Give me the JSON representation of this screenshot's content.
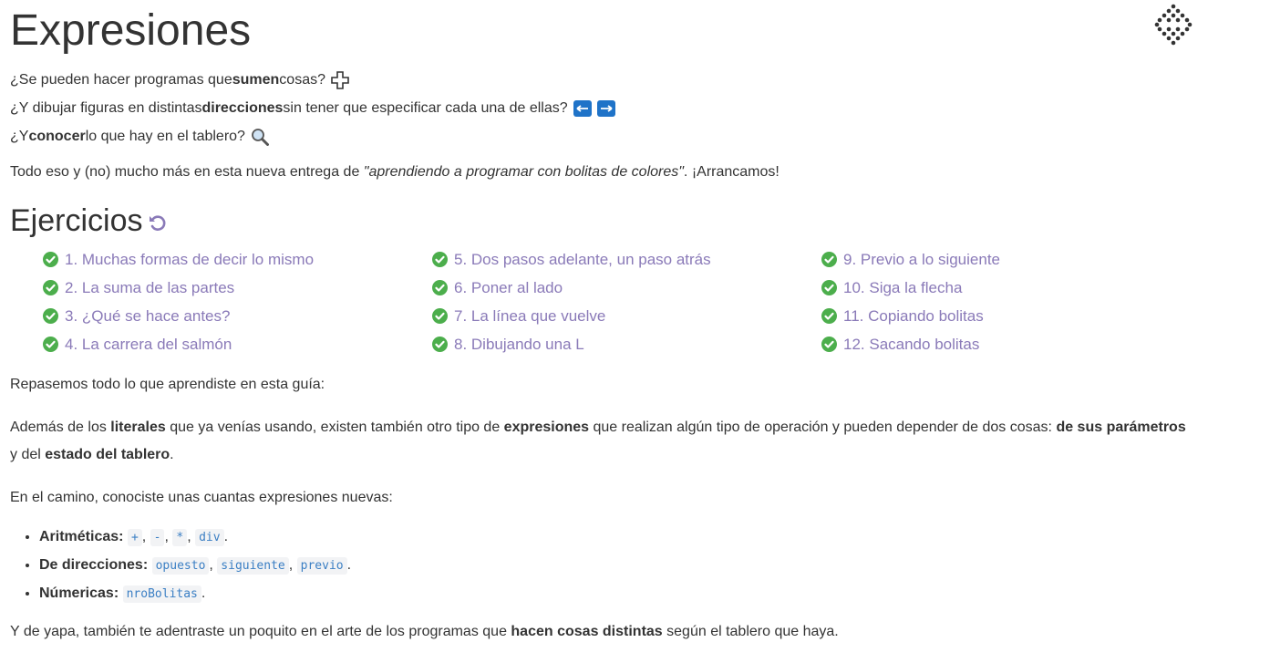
{
  "page": {
    "title": "Expresiones",
    "intro": {
      "line1": {
        "pre": "¿Se pueden hacer programas que ",
        "bold": "sumen",
        "post": " cosas?"
      },
      "line2": {
        "pre": "¿Y dibujar figuras en distintas ",
        "bold": "direcciones",
        "post": " sin tener que especificar cada una de ellas?"
      },
      "line3": {
        "pre": "¿Y ",
        "bold": "conocer",
        "post": " lo que hay en el tablero?"
      },
      "paragraph": {
        "pre": "Todo eso y (no) mucho más en esta nueva entrega de ",
        "italic": "\"aprendiendo a programar con bolitas de colores\"",
        "post": ". ¡Arrancamos!"
      }
    },
    "exercises_title": "Ejercicios",
    "exercises": [
      {
        "label": "1. Muchas formas de decir lo mismo"
      },
      {
        "label": "2. La suma de las partes"
      },
      {
        "label": "3. ¿Qué se hace antes?"
      },
      {
        "label": "4. La carrera del salmón"
      },
      {
        "label": "5. Dos pasos adelante, un paso atrás"
      },
      {
        "label": "6. Poner al lado"
      },
      {
        "label": "7. La línea que vuelve"
      },
      {
        "label": "8. Dibujando una L"
      },
      {
        "label": "9. Previo a lo siguiente"
      },
      {
        "label": "10. Siga la flecha"
      },
      {
        "label": "11. Copiando bolitas"
      },
      {
        "label": "12. Sacando bolitas"
      }
    ],
    "summary": {
      "intro": "Repasemos todo lo que aprendiste en esta guía:",
      "p1": {
        "a": "Además de los ",
        "b": "literales",
        "c": " que ya venías usando, existen también otro tipo de ",
        "d": "expresiones",
        "e": " que realizan algún tipo de operación y pueden depender de dos cosas: ",
        "f": "de sus parámetros",
        "g": "y del ",
        "h": "estado del tablero",
        "i": "."
      },
      "p2": "En el camino, conociste unas cuantas expresiones nuevas:",
      "list": {
        "arith_label": "Aritméticas:",
        "arith": [
          "+",
          "-",
          "*",
          "div"
        ],
        "dir_label": "De direcciones:",
        "dir": [
          "opuesto",
          "siguiente",
          "previo"
        ],
        "num_label": "Númericas:",
        "num": [
          "nroBolitas"
        ],
        "sep": ", ",
        "end": "."
      },
      "last": {
        "pre": "Y de yapa, también te adentraste un poquito en el arte de los programas que ",
        "bold": "hacen cosas distintas",
        "post": " según el tablero que haya."
      }
    }
  },
  "colors": {
    "accent": "#8a7ab8",
    "check": "#4cae4c",
    "code": "#3b7fc4",
    "key_blue": "#1f73c8"
  },
  "icons": [
    "plus-icon",
    "left-arrow-icon",
    "right-arrow-icon",
    "magnifier-icon",
    "reset-icon",
    "check-icon",
    "logo-icon"
  ]
}
